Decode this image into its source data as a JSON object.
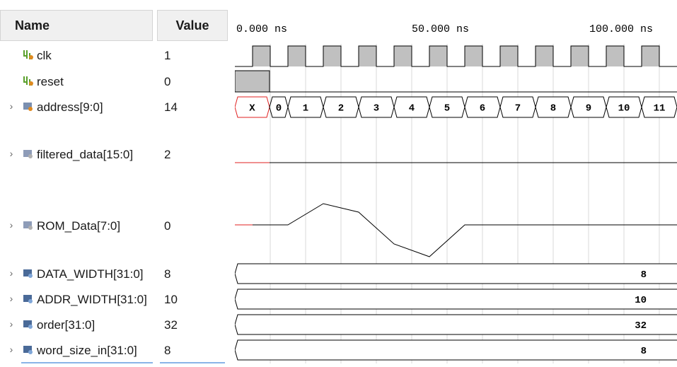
{
  "header": {
    "name_label": "Name",
    "value_label": "Value"
  },
  "timeline": {
    "labels": [
      "0.000 ns",
      "50.000 ns",
      "100.000 ns"
    ]
  },
  "signals": [
    {
      "name": "clk",
      "value": "1",
      "expandable": false,
      "icon": "bit-signal-icon"
    },
    {
      "name": "reset",
      "value": "0",
      "expandable": false,
      "icon": "bit-signal-icon"
    },
    {
      "name": "address[9:0]",
      "value": "14",
      "expandable": true,
      "icon": "bus-signal-icon"
    },
    {
      "name": "filtered_data[15:0]",
      "value": "2",
      "expandable": true,
      "icon": "analog-signal-icon"
    },
    {
      "name": "ROM_Data[7:0]",
      "value": "0",
      "expandable": true,
      "icon": "analog-signal-icon"
    },
    {
      "name": "DATA_WIDTH[31:0]",
      "value": "8",
      "expandable": true,
      "icon": "parameter-icon"
    },
    {
      "name": "ADDR_WIDTH[31:0]",
      "value": "10",
      "expandable": true,
      "icon": "parameter-icon"
    },
    {
      "name": "order[31:0]",
      "value": "32",
      "expandable": true,
      "icon": "parameter-icon"
    },
    {
      "name": "word_size_in[31:0]",
      "value": "8",
      "expandable": true,
      "icon": "parameter-icon"
    }
  ],
  "waveforms": {
    "address_labels": [
      "X",
      "0",
      "1",
      "2",
      "3",
      "4",
      "5",
      "6",
      "7",
      "8",
      "9",
      "10",
      "11"
    ],
    "rom_data_points": [
      0,
      0,
      1,
      0.6,
      -0.9,
      -1.5,
      0,
      0,
      0,
      0,
      0,
      0,
      0
    ],
    "param_values": [
      "8",
      "10",
      "32",
      "8"
    ]
  },
  "colors": {
    "wave_fill": "#c0c0c0",
    "undefined": "#e02020",
    "line": "#000000"
  }
}
